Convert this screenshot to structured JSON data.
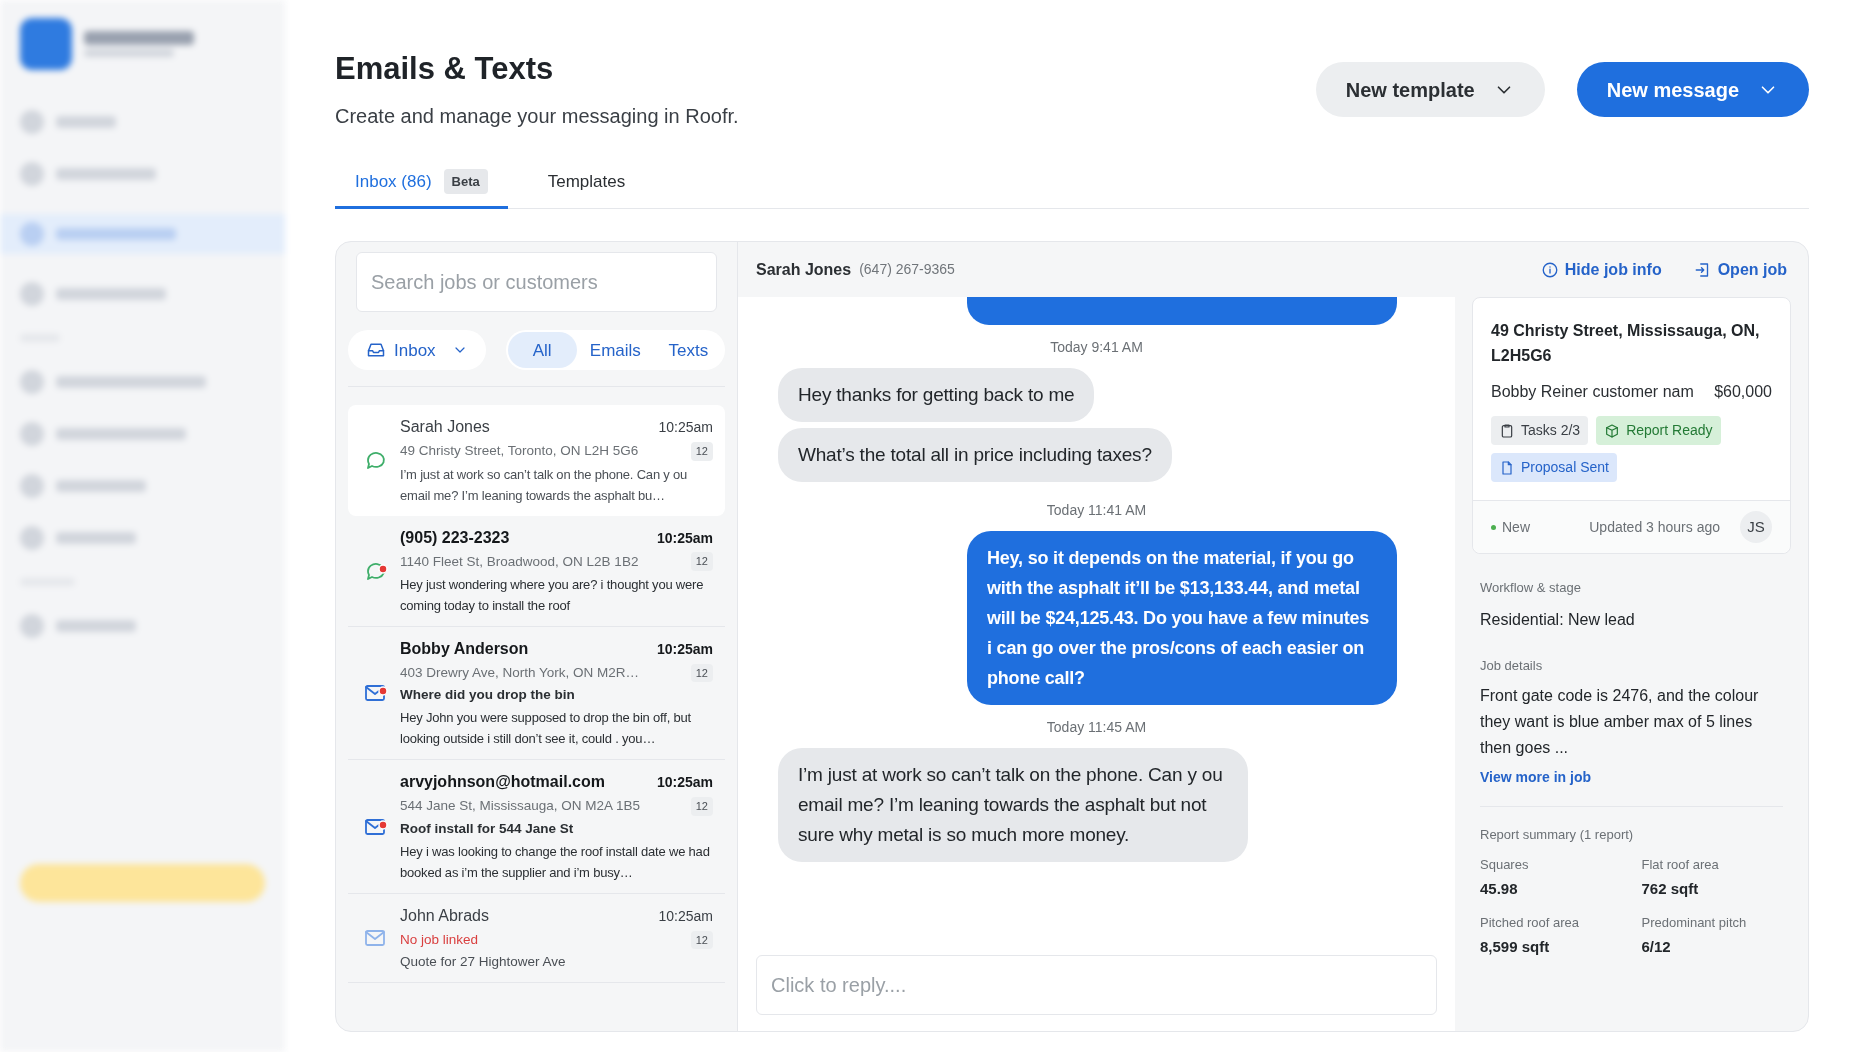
{
  "page": {
    "title": "Emails & Texts",
    "subtitle": "Create and manage your messaging in Roofr."
  },
  "header_buttons": [
    {
      "label": "New template",
      "kind": "secondary"
    },
    {
      "label": "New message",
      "kind": "primary"
    }
  ],
  "tabs": [
    {
      "label": "Inbox (86)",
      "badge": "Beta",
      "selected": true
    },
    {
      "label": "Templates",
      "selected": false
    }
  ],
  "search": {
    "placeholder": "Search jobs or customers"
  },
  "folder": {
    "label": "Inbox"
  },
  "filters": [
    {
      "label": "All",
      "selected": true
    },
    {
      "label": "Emails",
      "selected": false
    },
    {
      "label": "Texts",
      "selected": false
    }
  ],
  "threads": [
    {
      "kind": "text",
      "unread": false,
      "selected": true,
      "name": "Sarah Jones",
      "time": "10:25am",
      "count": "12",
      "address": "49 Christy Street, Toronto, ON L2H 5G6",
      "address_missing": false,
      "preview": "I’m just at work so can’t talk on the phone. Can y ou email me? I’m leaning towards the asphalt bu…"
    },
    {
      "kind": "text",
      "unread": true,
      "selected": false,
      "name": "(905) 223-2323",
      "time": "10:25am",
      "count": "12",
      "address": "1140 Fleet St, Broadwood, ON L2B 1B2",
      "address_missing": false,
      "preview": "Hey just wondering where you are? i thought you were coming today to install the roof"
    },
    {
      "kind": "email",
      "unread": true,
      "selected": false,
      "name": "Bobby Anderson",
      "time": "10:25am",
      "count": "12",
      "address": "403 Drewry Ave, North York, ON M2R…",
      "address_missing": false,
      "subject": "Where did you drop the bin",
      "preview": "Hey John you were supposed to drop the bin off, but looking outside i still don’t see it, could . you…"
    },
    {
      "kind": "email",
      "unread": true,
      "selected": false,
      "name": "arvyjohnson@hotmail.com",
      "time": "10:25am",
      "count": "12",
      "address": "544 Jane St, Mississauga, ON M2A 1B5",
      "address_missing": false,
      "subject": "Roof install for 544 Jane St",
      "preview": "Hey i was looking to change the roof install date we had booked as i’m the supplier and i’m busy…"
    },
    {
      "kind": "email",
      "unread": false,
      "selected": false,
      "name": "John Abrads",
      "time": "10:25am",
      "count": "12",
      "address": "No job linked",
      "address_missing": true,
      "subject": "Quote for 27 Hightower Ave"
    }
  ],
  "conversation": {
    "name": "Sarah Jones",
    "phone": "(647) 267-9365",
    "actions": [
      {
        "label": "Hide job info",
        "kind": "info"
      },
      {
        "label": "Open job",
        "kind": "open"
      }
    ],
    "messages": [
      {
        "kind": "outgoing_cut"
      },
      {
        "kind": "timestamp",
        "text": "Today 9:41 AM"
      },
      {
        "kind": "incoming",
        "text": "Hey thanks for getting back to me"
      },
      {
        "kind": "incoming",
        "text": "What’s the total all in price including taxes?"
      },
      {
        "kind": "timestamp",
        "text": "Today 11:41 AM"
      },
      {
        "kind": "outgoing",
        "text": "Hey, so it depends on the material, if you go with the asphalt it’ll be $13,133.44, and metal will be $24,125.43. Do you have a few minutes i can go over the pros/cons of each easier on phone call?"
      },
      {
        "kind": "timestamp",
        "text": "Today 11:45 AM"
      },
      {
        "kind": "incoming",
        "text": "I’m just at work so can’t talk on the phone. Can y ou email me? I’m leaning towards the asphalt but not sure why metal is so much more money."
      }
    ],
    "reply_placeholder": "Click to reply...."
  },
  "job": {
    "address": "49 Christy Street, Mississauga, ON, L2H5G6",
    "customer": "Bobby Reiner customer nam",
    "value": "$60,000",
    "chips": [
      {
        "label": "Tasks 2/3",
        "kind": "tasks"
      },
      {
        "label": "Report Ready",
        "kind": "report"
      },
      {
        "label": "Proposal Sent",
        "kind": "proposal"
      }
    ],
    "status": {
      "label": "New",
      "color": "#4caf50"
    },
    "updated": "Updated 3 hours ago",
    "assignee": "JS",
    "workflow_label": "Workflow & stage",
    "workflow": "Residential: New lead",
    "details_label": "Job details",
    "details": "Front gate code is 2476, and the colour they want is blue amber max of 5 lines then goes ...",
    "details_link": "View more in job",
    "report_label": "Report summary (1 report)",
    "report": [
      {
        "label": "Squares",
        "value": "45.98"
      },
      {
        "label": "Flat roof area",
        "value": "762 sqft"
      },
      {
        "label": "Pitched roof area",
        "value": "8,599 sqft"
      },
      {
        "label": "Predominant pitch",
        "value": "6/12"
      }
    ]
  }
}
